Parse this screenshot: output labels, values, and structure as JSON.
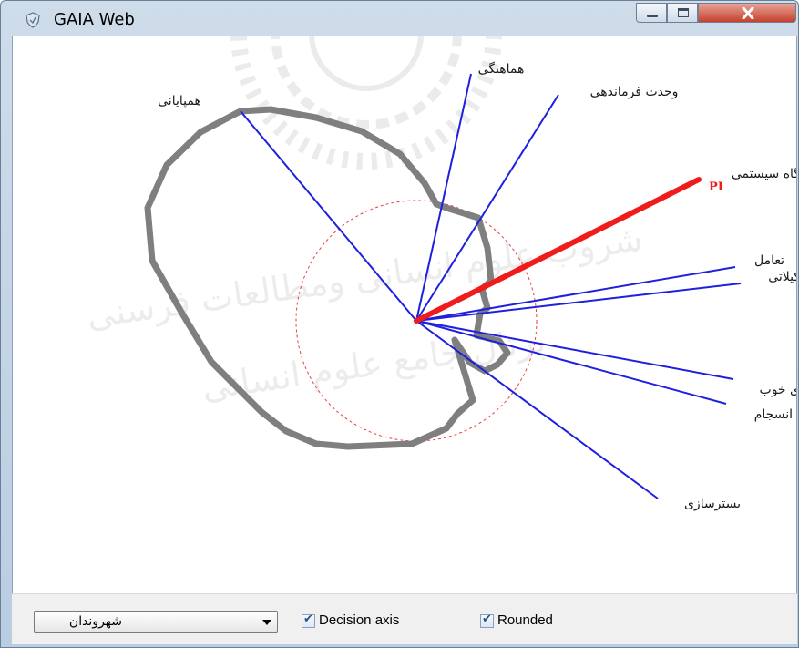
{
  "window": {
    "title": "GAIA Web",
    "controls": [
      "minimize-icon",
      "maximize-icon",
      "close-icon"
    ],
    "frame_color": "#b9cde2"
  },
  "plot": {
    "criteria_labels": [
      "هماهنگی",
      "وحدت فرماندهی",
      "همپایانی",
      "گاه سیستمی",
      "تعامل",
      "کیلاتی",
      "ی خوب",
      "انسجام",
      "بسترسازی"
    ],
    "pi_label": "PI",
    "colors": {
      "axis": "#1f1fe0",
      "pi": "#f01c1c",
      "polygon": "#7f7f7f",
      "circle": "#e84040"
    },
    "watermark_text": "شروب علوم انسانی ومطالعات فرسنی پرتال جامع علوم انسانی"
  },
  "controls": {
    "scenario_select": {
      "value": "شهروندان",
      "icon": "chevron-down-icon"
    },
    "decision_axis": {
      "label": "Decision axis",
      "checked": true
    },
    "rounded": {
      "label": "Rounded",
      "checked": true
    }
  }
}
